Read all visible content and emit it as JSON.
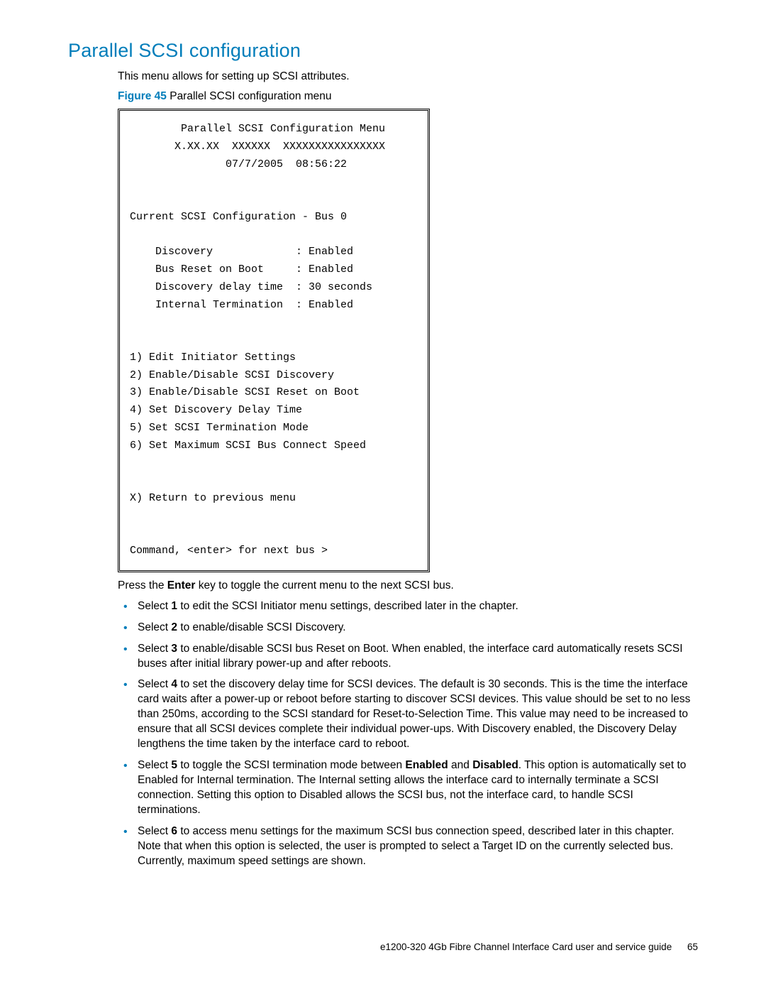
{
  "heading": "Parallel SCSI configuration",
  "intro": "This menu allows for setting up SCSI attributes.",
  "figure": {
    "prefix": "Figure 45",
    "caption": " Parallel SCSI configuration menu"
  },
  "terminal": {
    "title_line": "        Parallel SCSI Configuration Menu",
    "version_line": "       X.XX.XX  XXXXXX  XXXXXXXXXXXXXXXX",
    "date_line": "               07/7/2005  08:56:22",
    "blank": "",
    "current_line": "Current SCSI Configuration - Bus 0",
    "cfg1": "    Discovery             : Enabled",
    "cfg2": "    Bus Reset on Boot     : Enabled",
    "cfg3": "    Discovery delay time  : 30 seconds",
    "cfg4": "    Internal Termination  : Enabled",
    "m1": "1) Edit Initiator Settings",
    "m2": "2) Enable/Disable SCSI Discovery",
    "m3": "3) Enable/Disable SCSI Reset on Boot",
    "m4": "4) Set Discovery Delay Time",
    "m5": "5) Set SCSI Termination Mode",
    "m6": "6) Set Maximum SCSI Bus Connect Speed",
    "mx": "X) Return to previous menu",
    "cmd": "Command, <enter> for next bus >"
  },
  "post_box": {
    "pre": "Press the ",
    "enter": "Enter",
    "post": " key to toggle the current menu to the next SCSI bus."
  },
  "bullets": {
    "b1": {
      "a": "Select ",
      "n": "1",
      "b": " to edit the SCSI Initiator menu settings, described later in the chapter."
    },
    "b2": {
      "a": "Select ",
      "n": "2",
      "b": " to enable/disable SCSI Discovery."
    },
    "b3": {
      "a": "Select ",
      "n": "3",
      "b": " to enable/disable SCSI bus Reset on Boot. When enabled, the interface card automatically resets SCSI buses after initial library power-up and after reboots."
    },
    "b4": {
      "a": "Select ",
      "n": "4",
      "b": " to set the discovery delay time for SCSI devices. The default is 30 seconds. This is the time the interface card waits after a power-up or reboot before starting to discover SCSI devices. This value should be set to no less than 250ms, according to the SCSI standard for Reset-to-Selection Time. This value may need to be increased to ensure that all SCSI devices complete their individual power-ups. With Discovery enabled, the Discovery Delay lengthens the time taken by the interface card to reboot."
    },
    "b5": {
      "a": "Select ",
      "n": "5",
      "b1": " to toggle the SCSI termination mode between ",
      "en": "Enabled",
      "b2": " and ",
      "dis": "Disabled",
      "b3": ". This option is automatically set to Enabled for Internal termination. The Internal setting allows the interface card to internally terminate a SCSI connection. Setting this option to Disabled allows the SCSI bus, not the interface card, to handle SCSI terminations."
    },
    "b6": {
      "a": "Select ",
      "n": "6",
      "b": " to access menu settings for the maximum SCSI bus connection speed, described later in this chapter. Note that when this option is selected, the user is prompted to select a Target ID on the currently selected bus. Currently, maximum speed settings are shown."
    }
  },
  "footer": {
    "title": "e1200-320 4Gb Fibre Channel Interface Card user and service guide",
    "page": "65"
  }
}
